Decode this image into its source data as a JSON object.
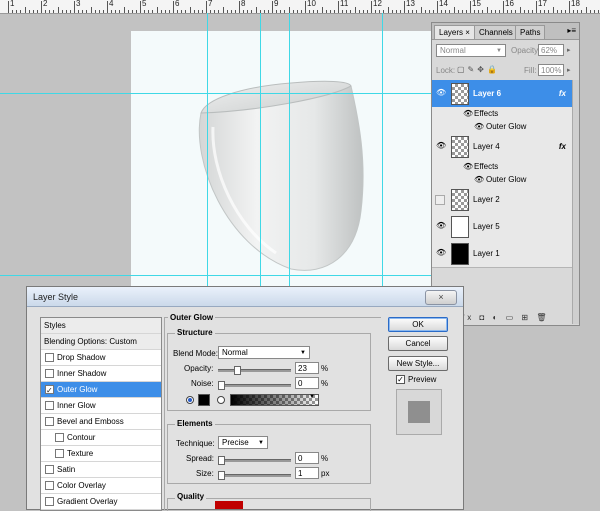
{
  "ruler": {
    "numbers": [
      "1",
      "2",
      "3",
      "4",
      "5",
      "6",
      "7",
      "8",
      "9",
      "10",
      "11",
      "12",
      "13",
      "14",
      "15",
      "16",
      "17",
      "18"
    ]
  },
  "layers_panel": {
    "tabs": [
      {
        "label": "Layers"
      },
      {
        "label": "Channels"
      },
      {
        "label": "Paths"
      }
    ],
    "tab_close": "×",
    "blend_mode": "Normal",
    "opacity_label": "Opacity:",
    "opacity_value": "62%",
    "lock_label": "Lock:",
    "fill_label": "Fill:",
    "fill_value": "100%",
    "layers": [
      {
        "name": "Layer 6",
        "fx": "fx",
        "effects": "Effects",
        "effect": "Outer Glow"
      },
      {
        "name": "Layer 4",
        "fx": "fx",
        "effects": "Effects",
        "effect": "Outer Glow"
      },
      {
        "name": "Layer 2"
      },
      {
        "name": "Layer 5"
      },
      {
        "name": "Layer 1"
      }
    ],
    "bottom_icons": [
      "link-icon",
      "fx-icon",
      "mask-icon",
      "adjustment-icon",
      "folder-icon",
      "new-layer-icon",
      "trash-icon"
    ]
  },
  "dialog": {
    "title": "Layer Style",
    "close": "×",
    "styles_header": "Styles",
    "blending_options": "Blending Options: Custom",
    "style_items": [
      {
        "label": "Drop Shadow",
        "checked": false
      },
      {
        "label": "Inner Shadow",
        "checked": false
      },
      {
        "label": "Outer Glow",
        "checked": true
      },
      {
        "label": "Inner Glow",
        "checked": false
      },
      {
        "label": "Bevel and Emboss",
        "checked": false
      },
      {
        "label": "Contour",
        "checked": false
      },
      {
        "label": "Texture",
        "checked": false
      },
      {
        "label": "Satin",
        "checked": false
      },
      {
        "label": "Color Overlay",
        "checked": false
      },
      {
        "label": "Gradient Overlay",
        "checked": false
      }
    ],
    "section_title": "Outer Glow",
    "structure": {
      "title": "Structure",
      "blend_mode_label": "Blend Mode:",
      "blend_mode_value": "Normal",
      "opacity_label": "Opacity:",
      "opacity_value": "23",
      "opacity_fraction": 0.23,
      "noise_label": "Noise:",
      "noise_value": "0",
      "noise_fraction": 0,
      "percent": "%"
    },
    "elements": {
      "title": "Elements",
      "technique_label": "Technique:",
      "technique_value": "Precise",
      "spread_label": "Spread:",
      "spread_value": "0",
      "spread_fraction": 0,
      "size_label": "Size:",
      "size_value": "1",
      "size_fraction": 0.004,
      "percent": "%",
      "px": "px"
    },
    "quality_title": "Quality",
    "buttons": {
      "ok": "OK",
      "cancel": "Cancel",
      "new_style": "New Style..."
    },
    "preview_label": "Preview",
    "preview_checked": true,
    "glow_color": "#000000"
  },
  "colors": {
    "selection": "#3d8ee8",
    "guide": "#3fd8e6"
  }
}
